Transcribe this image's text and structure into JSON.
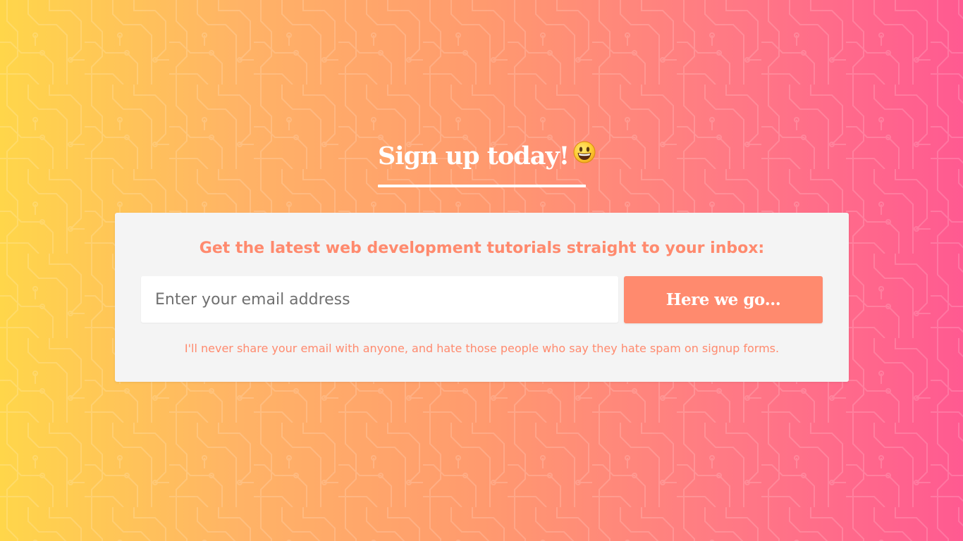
{
  "heading": {
    "text": "Sign up today!",
    "emoji_icon": "grinning-face-icon"
  },
  "signup_card": {
    "title": "Get the latest web development tutorials straight to your inbox:",
    "email_placeholder": "Enter your email address",
    "email_value": "",
    "submit_label": "Here we go…",
    "disclaimer": "I'll never share your email with anyone, and hate those people who say they hate spam on signup forms."
  },
  "colors": {
    "gradient_start": "#ffd64a",
    "gradient_end": "#ff5a91",
    "accent": "#ff8a6e",
    "card_background": "#f4f4f4",
    "heading_text": "#ffffff"
  }
}
